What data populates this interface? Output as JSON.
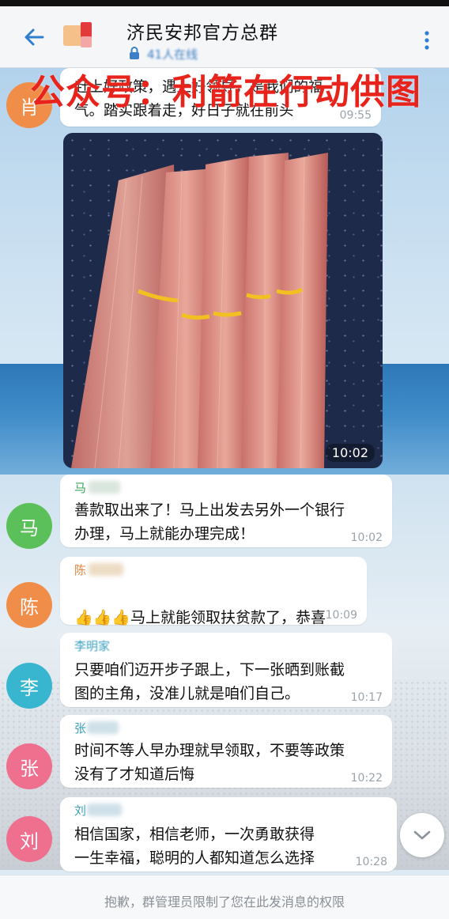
{
  "header": {
    "title": "济民安邦官方总群",
    "member_count": "41人在线"
  },
  "watermark": "公众号：利箭在行动供图",
  "messages": [
    {
      "avatar": "肖",
      "avatar_color": "#f08d49",
      "text": "赶上好政策，遇上好领导，是我们的福\n气。踏实跟着走，好日子就在前头",
      "time": "09:55"
    },
    {
      "photo_time": "10:02"
    },
    {
      "avatar": "马",
      "avatar_color": "#5cc05a",
      "sender": "马",
      "text": "善款取出来了！马上出发去另外一个银行\n办理，马上就能办理完成！",
      "time": "10:02"
    },
    {
      "avatar": "陈",
      "avatar_color": "#f08d49",
      "sender": "陈",
      "emoji": "👍👍👍",
      "text": "马上就能领取扶贫款了，恭喜",
      "time": "10:09"
    },
    {
      "avatar": "李",
      "avatar_color": "#38b6cf",
      "sender": "李明家",
      "text": "只要咱们迈开步子跟上，下一张晒到账截\n图的主角，没准儿就是咱们自己。",
      "time": "10:17"
    },
    {
      "avatar": "张",
      "avatar_color": "#ef6f8e",
      "sender": "张",
      "text": "时间不等人早办理就早领取，不要等政策\n没有了才知道后悔",
      "time": "10:22"
    },
    {
      "avatar": "刘",
      "avatar_color": "#ef6f8e",
      "sender": "刘",
      "text": "相信国家，相信老师，一次勇敢获得\n一生幸福，聪明的人都知道怎么选择",
      "time": "10:28"
    }
  ],
  "footer": {
    "restricted_notice": "抱歉，群管理员限制了您在此发消息的权限"
  },
  "icons": [
    "back-arrow-icon",
    "lock-icon",
    "more-vertical-icon",
    "chevron-down-icon"
  ]
}
